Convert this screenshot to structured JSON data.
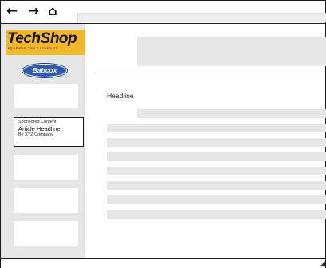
{
  "navigation": {
    "back_icon": "left-arrow-icon",
    "back_glyph": "←",
    "forward_icon": "right-arrow-icon",
    "forward_glyph": "→",
    "home_icon": "home-icon",
    "home_glyph": "⌂"
  },
  "sidebar": {
    "logo": {
      "name": "TechShop",
      "tagline": "Equipment, Tools & Supplies",
      "color": "#f5b72a"
    },
    "brand_badge": {
      "name": "Babcox",
      "color": "#2f5ab0"
    },
    "sponsored": {
      "tag": "Sponsored Content",
      "headline": "Article Headline",
      "byline": "By XYZ Company"
    }
  },
  "main": {
    "headline": "Headline"
  },
  "colors": {
    "placeholder": "#e6e6e6",
    "border": "#1a1a1a"
  }
}
